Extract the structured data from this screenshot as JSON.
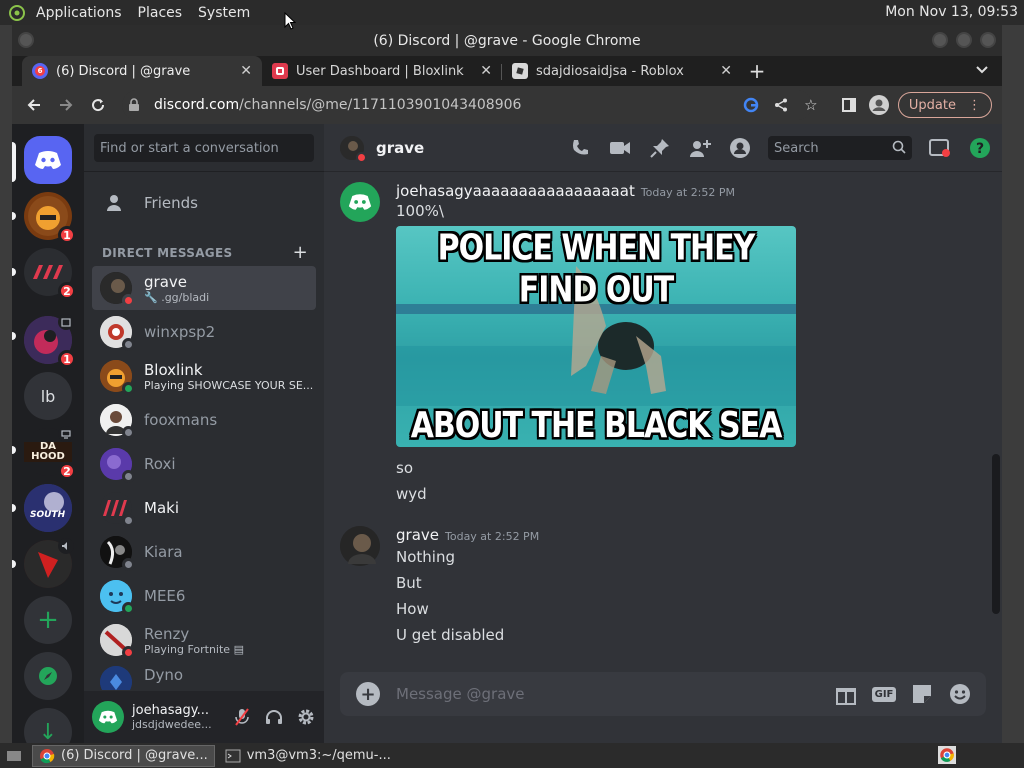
{
  "top_panel": {
    "menus": [
      "Applications",
      "Places",
      "System"
    ],
    "clock": "Mon Nov 13, 09:53"
  },
  "window": {
    "title": "(6) Discord | @grave - Google Chrome"
  },
  "tabs": [
    {
      "title": "(6) Discord | @grave",
      "badge": "6"
    },
    {
      "title": "User Dashboard | Bloxlink"
    },
    {
      "title": "sdajdiosaidjsa - Roblox"
    }
  ],
  "omnibox": {
    "host": "discord.com",
    "path": "/channels/@me/1171103901043408906"
  },
  "toolbar": {
    "update_label": "Update"
  },
  "guilds": [
    {
      "badge": "1"
    },
    {
      "badge": "2"
    },
    {
      "badge": "1"
    },
    {
      "label": "lb"
    },
    {
      "badge": "2",
      "text": "DA HOOD"
    },
    {
      "text": "SOUTH"
    },
    {}
  ],
  "dm_sidebar": {
    "search_placeholder": "Find or start a conversation",
    "friends_label": "Friends",
    "section_title": "DIRECT MESSAGES",
    "items": [
      {
        "name": "grave",
        "sub": ".gg/bladi"
      },
      {
        "name": "winxpsp2"
      },
      {
        "name": "Bloxlink",
        "sub": "Playing SHOWCASE YOUR SE..."
      },
      {
        "name": "fooxmans"
      },
      {
        "name": "Roxi"
      },
      {
        "name": "Maki"
      },
      {
        "name": "Kiara"
      },
      {
        "name": "MEE6"
      },
      {
        "name": "Renzy",
        "sub": "Playing Fortnite"
      },
      {
        "name": "Dyno"
      }
    ]
  },
  "user_panel": {
    "name": "joehasagy...",
    "sub": "jdsdjdwedee..."
  },
  "chat": {
    "recipient": "grave",
    "search_placeholder": "Search",
    "messages": [
      {
        "author": "joehasagyaaaaaaaaaaaaaaaaat",
        "time": "Today at 2:52 PM",
        "lines_before": [
          "100%\\"
        ],
        "meme_top": "POLICE WHEN THEY FIND OUT",
        "meme_bottom": "ABOUT THE BLACK SEA",
        "lines_after": [
          "so",
          "wyd"
        ]
      },
      {
        "author": "grave",
        "time": "Today at 2:52 PM",
        "lines": [
          "Nothing",
          "But",
          "How",
          "U get disabled"
        ]
      }
    ],
    "composer_placeholder": "Message @grave",
    "gif_label": "GIF"
  },
  "taskbar": {
    "tasks": [
      {
        "label": "(6) Discord | @grave..."
      },
      {
        "label": "vm3@vm3:~/qemu-..."
      }
    ]
  },
  "colors": {
    "blurple": "#5865f2",
    "green": "#23a55a",
    "red": "#f23f43",
    "dnd": "#f23f43",
    "idle": "#80848e"
  }
}
